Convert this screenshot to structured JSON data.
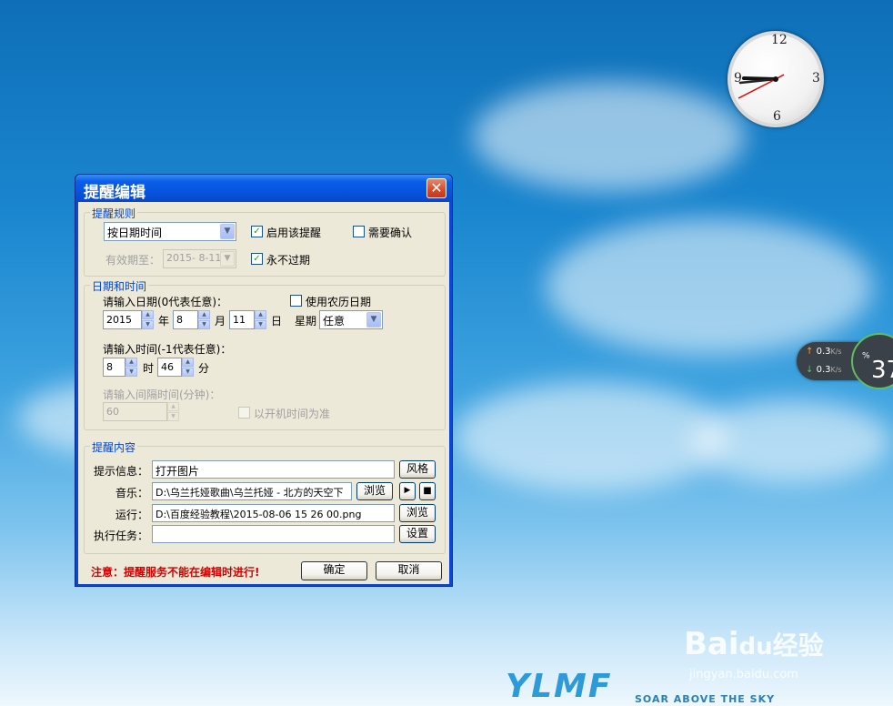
{
  "desktop": {
    "clock": {
      "n12": "12",
      "n3": "3",
      "n6": "6",
      "n9": "9"
    },
    "netmeter": {
      "up": "0.3",
      "down": "0.3",
      "unit": "K/s",
      "percent": "37",
      "percent_sign": "%"
    },
    "watermark": {
      "brand": "Bai",
      "brand_paw": "du",
      "brand_suffix": "经验",
      "url": "jingyan.baidu.com"
    },
    "logo": {
      "text": "YLMF",
      "tagline": "SOAR ABOVE THE SKY"
    }
  },
  "dialog": {
    "title": "提醒编辑",
    "close_glyph": "✕",
    "rules": {
      "legend": "提醒规则",
      "type_value": "按日期时间",
      "enable_label": "启用该提醒",
      "enable_checked": true,
      "confirm_label": "需要确认",
      "confirm_checked": false,
      "valid_until_label": "有效期至：",
      "valid_until_value": "2015- 8-11",
      "never_expire_label": "永不过期",
      "never_expire_checked": true
    },
    "datetime": {
      "legend": "日期和时间",
      "date_prompt": "请输入日期(0代表任意)：",
      "lunar_label": "使用农历日期",
      "year": "2015",
      "year_unit": "年",
      "month": "8",
      "month_unit": "月",
      "day": "11",
      "day_unit": "日",
      "weekday_label": "星期",
      "weekday_value": "任意",
      "time_prompt": "请输入时间(-1代表任意)：",
      "hour": "8",
      "hour_unit": "时",
      "minute": "46",
      "minute_unit": "分",
      "interval_prompt": "请输入间隔时间(分钟)：",
      "interval_value": "60",
      "boot_label": "以开机时间为准"
    },
    "content": {
      "legend": "提醒内容",
      "message_label": "提示信息：",
      "message_value": "打开图片",
      "style_button": "风格",
      "music_label": "音乐：",
      "music_value": "D:\\乌兰托娅歌曲\\乌兰托娅 - 北方的天空下",
      "browse_button": "浏览",
      "play_glyph": "▶",
      "stop_glyph": "■",
      "run_label": "运行：",
      "run_value": "D:\\百度经验教程\\2015-08-06 15 26 00.png",
      "browse2_button": "浏览",
      "task_label": "执行任务：",
      "task_value": "",
      "settings_button": "设置"
    },
    "footer": {
      "note": "注意：提醒服务不能在编辑时进行!",
      "ok_button": "确定",
      "cancel_button": "取消"
    }
  }
}
